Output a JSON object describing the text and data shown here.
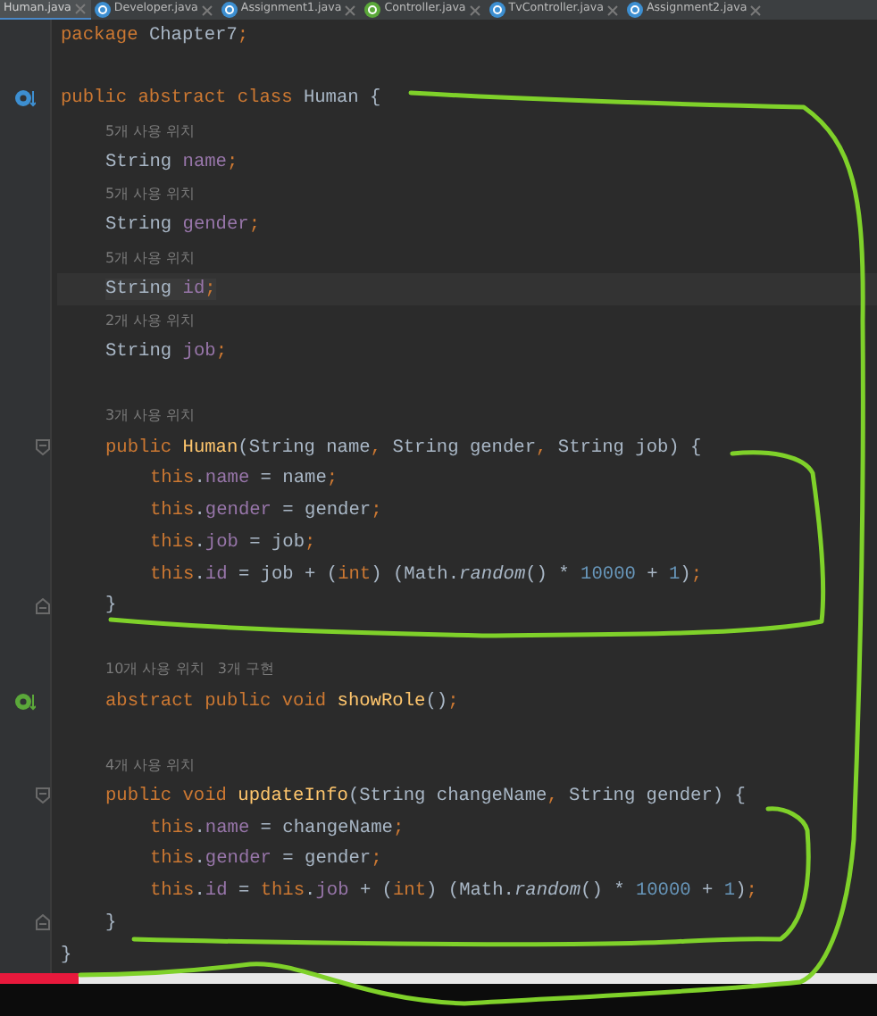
{
  "tabs": [
    {
      "label": "Human.java",
      "selected": true,
      "kind": "plain"
    },
    {
      "label": "Developer.java",
      "selected": false,
      "kind": "class"
    },
    {
      "label": "Assignment1.java",
      "selected": false,
      "kind": "class"
    },
    {
      "label": "Controller.java",
      "selected": false,
      "kind": "interface"
    },
    {
      "label": "TvController.java",
      "selected": false,
      "kind": "class"
    },
    {
      "label": "Assignment2.java",
      "selected": false,
      "kind": "class"
    }
  ],
  "editor": {
    "lines": [
      {
        "kind": "code",
        "tokens": [
          {
            "t": "package ",
            "kind": "keyword"
          },
          {
            "t": "Chapter7",
            "kind": "plain"
          },
          {
            "t": ";",
            "kind": "punct"
          }
        ]
      },
      {
        "kind": "blank"
      },
      {
        "kind": "code",
        "gutter": {
          "kind": "implemented"
        },
        "tokens": [
          {
            "t": "public abstract class ",
            "kind": "keyword"
          },
          {
            "t": "Human {",
            "kind": "plain"
          }
        ],
        "children": [
          {
            "kind": "hint",
            "text": "5개 사용 위치"
          },
          {
            "kind": "code",
            "tokens": [
              {
                "t": "String ",
                "kind": "plain"
              },
              {
                "t": "name",
                "kind": "field"
              },
              {
                "t": ";",
                "kind": "punct"
              }
            ]
          },
          {
            "kind": "hint",
            "text": "5개 사용 위치"
          },
          {
            "kind": "code",
            "tokens": [
              {
                "t": "String ",
                "kind": "plain"
              },
              {
                "t": "gender",
                "kind": "field"
              },
              {
                "t": ";",
                "kind": "punct"
              }
            ]
          },
          {
            "kind": "hint",
            "text": "5개 사용 위치"
          },
          {
            "kind": "code",
            "current": true,
            "tokens": [
              {
                "t": "String ",
                "kind": "plain"
              },
              {
                "t": "id",
                "kind": "field"
              },
              {
                "t": ";",
                "kind": "punct"
              }
            ]
          },
          {
            "kind": "hint",
            "text": "2개 사용 위치"
          },
          {
            "kind": "code",
            "tokens": [
              {
                "t": "String ",
                "kind": "plain"
              },
              {
                "t": "job",
                "kind": "field"
              },
              {
                "t": ";",
                "kind": "punct"
              }
            ]
          },
          {
            "kind": "blank"
          },
          {
            "kind": "hint",
            "text": "3개 사용 위치"
          },
          {
            "kind": "code",
            "gutter": {
              "kind": "fold-start"
            },
            "tokens": [
              {
                "t": "public ",
                "kind": "keyword"
              },
              {
                "t": "Human",
                "kind": "method"
              },
              {
                "t": "(String name",
                "kind": "plain"
              },
              {
                "t": ", ",
                "kind": "punct"
              },
              {
                "t": "String gender",
                "kind": "plain"
              },
              {
                "t": ", ",
                "kind": "punct"
              },
              {
                "t": "String job) {",
                "kind": "plain"
              }
            ],
            "children": [
              {
                "kind": "code",
                "tokens": [
                  {
                    "t": "this",
                    "kind": "keyword"
                  },
                  {
                    "t": ".",
                    "kind": "plain"
                  },
                  {
                    "t": "name",
                    "kind": "field"
                  },
                  {
                    "t": " = name",
                    "kind": "plain"
                  },
                  {
                    "t": ";",
                    "kind": "punct"
                  }
                ]
              },
              {
                "kind": "code",
                "tokens": [
                  {
                    "t": "this",
                    "kind": "keyword"
                  },
                  {
                    "t": ".",
                    "kind": "plain"
                  },
                  {
                    "t": "gender",
                    "kind": "field"
                  },
                  {
                    "t": " = gender",
                    "kind": "plain"
                  },
                  {
                    "t": ";",
                    "kind": "punct"
                  }
                ]
              },
              {
                "kind": "code",
                "tokens": [
                  {
                    "t": "this",
                    "kind": "keyword"
                  },
                  {
                    "t": ".",
                    "kind": "plain"
                  },
                  {
                    "t": "job",
                    "kind": "field"
                  },
                  {
                    "t": " = job",
                    "kind": "plain"
                  },
                  {
                    "t": ";",
                    "kind": "punct"
                  }
                ]
              },
              {
                "kind": "code",
                "tokens": [
                  {
                    "t": "this",
                    "kind": "keyword"
                  },
                  {
                    "t": ".",
                    "kind": "plain"
                  },
                  {
                    "t": "id",
                    "kind": "field"
                  },
                  {
                    "t": " = job + (",
                    "kind": "plain"
                  },
                  {
                    "t": "int",
                    "kind": "keyword"
                  },
                  {
                    "t": ") (Math.",
                    "kind": "plain"
                  },
                  {
                    "t": "random",
                    "kind": "italic"
                  },
                  {
                    "t": "() * ",
                    "kind": "plain"
                  },
                  {
                    "t": "10000",
                    "kind": "number"
                  },
                  {
                    "t": " + ",
                    "kind": "plain"
                  },
                  {
                    "t": "1",
                    "kind": "number"
                  },
                  {
                    "t": ")",
                    "kind": "plain"
                  },
                  {
                    "t": ";",
                    "kind": "punct"
                  }
                ]
              }
            ]
          },
          {
            "kind": "code",
            "gutter": {
              "kind": "fold-end"
            },
            "tokens": [
              {
                "t": "}",
                "kind": "plain"
              }
            ]
          },
          {
            "kind": "blank"
          },
          {
            "kind": "hint",
            "text": "10개 사용 위치   3개 구현"
          },
          {
            "kind": "code",
            "gutter": {
              "kind": "implementing"
            },
            "tokens": [
              {
                "t": "abstract public void ",
                "kind": "keyword"
              },
              {
                "t": "showRole",
                "kind": "method"
              },
              {
                "t": "()",
                "kind": "plain"
              },
              {
                "t": ";",
                "kind": "punct"
              }
            ]
          },
          {
            "kind": "blank"
          },
          {
            "kind": "hint",
            "text": "4개 사용 위치"
          },
          {
            "kind": "code",
            "gutter": {
              "kind": "fold-start"
            },
            "tokens": [
              {
                "t": "public void ",
                "kind": "keyword"
              },
              {
                "t": "updateInfo",
                "kind": "method"
              },
              {
                "t": "(String changeName",
                "kind": "plain"
              },
              {
                "t": ", ",
                "kind": "punct"
              },
              {
                "t": "String gender) {",
                "kind": "plain"
              }
            ],
            "children": [
              {
                "kind": "code",
                "tokens": [
                  {
                    "t": "this",
                    "kind": "keyword"
                  },
                  {
                    "t": ".",
                    "kind": "plain"
                  },
                  {
                    "t": "name",
                    "kind": "field"
                  },
                  {
                    "t": " = changeName",
                    "kind": "plain"
                  },
                  {
                    "t": ";",
                    "kind": "punct"
                  }
                ]
              },
              {
                "kind": "code",
                "tokens": [
                  {
                    "t": "this",
                    "kind": "keyword"
                  },
                  {
                    "t": ".",
                    "kind": "plain"
                  },
                  {
                    "t": "gender",
                    "kind": "field"
                  },
                  {
                    "t": " = gender",
                    "kind": "plain"
                  },
                  {
                    "t": ";",
                    "kind": "punct"
                  }
                ]
              },
              {
                "kind": "code",
                "tokens": [
                  {
                    "t": "this",
                    "kind": "keyword"
                  },
                  {
                    "t": ".",
                    "kind": "plain"
                  },
                  {
                    "t": "id",
                    "kind": "field"
                  },
                  {
                    "t": " = ",
                    "kind": "plain"
                  },
                  {
                    "t": "this",
                    "kind": "keyword"
                  },
                  {
                    "t": ".",
                    "kind": "plain"
                  },
                  {
                    "t": "job",
                    "kind": "field"
                  },
                  {
                    "t": " + (",
                    "kind": "plain"
                  },
                  {
                    "t": "int",
                    "kind": "keyword"
                  },
                  {
                    "t": ") (Math.",
                    "kind": "plain"
                  },
                  {
                    "t": "random",
                    "kind": "italic"
                  },
                  {
                    "t": "() * ",
                    "kind": "plain"
                  },
                  {
                    "t": "10000",
                    "kind": "number"
                  },
                  {
                    "t": " + ",
                    "kind": "plain"
                  },
                  {
                    "t": "1",
                    "kind": "number"
                  },
                  {
                    "t": ")",
                    "kind": "plain"
                  },
                  {
                    "t": ";",
                    "kind": "punct"
                  }
                ]
              }
            ]
          },
          {
            "kind": "code",
            "gutter": {
              "kind": "fold-end"
            },
            "tokens": [
              {
                "t": "}",
                "kind": "plain"
              }
            ]
          }
        ]
      },
      {
        "kind": "code",
        "tokens": [
          {
            "t": "}",
            "kind": "plain"
          }
        ]
      }
    ]
  },
  "video_progress": {
    "level": 0.09
  }
}
